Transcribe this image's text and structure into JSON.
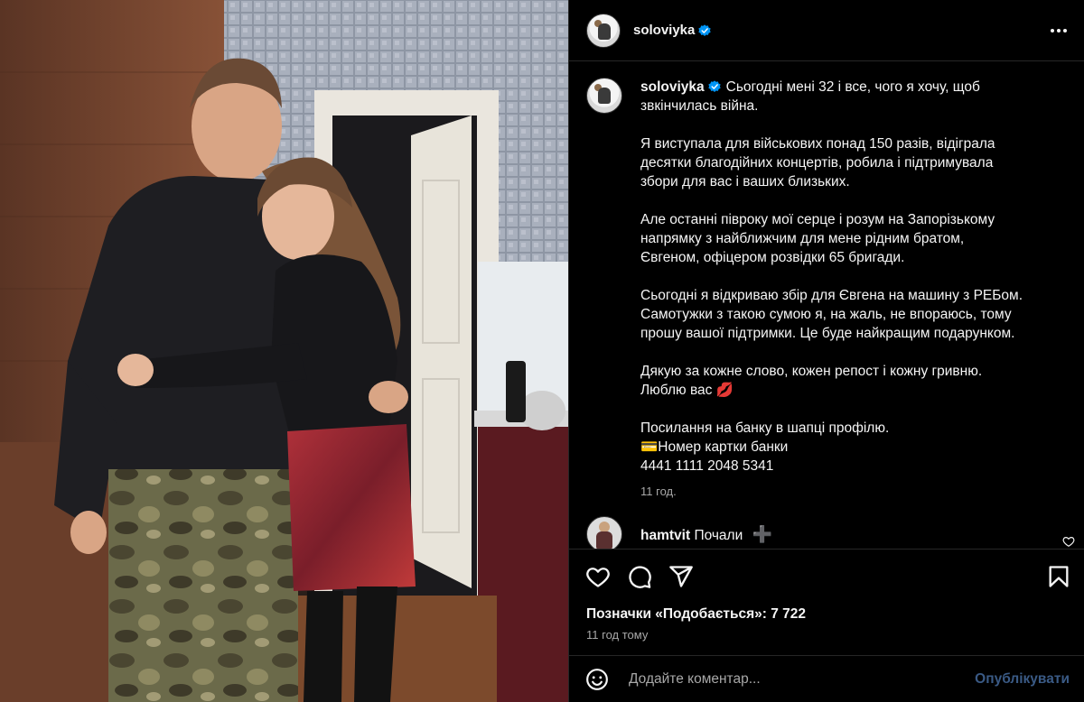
{
  "post": {
    "username": "soloviyka",
    "verified": true,
    "caption_lines": "Сьогодні мені 32 і все, чого я хочу, щоб\nзвкінчилась війна.\n\nЯ виступала для військових понад 150 разів, відіграла\nдесятки благодійних концертів, робила і підтримувала\nзбори для вас і ваших близьких.\n\nАле останні півроку мої серце і розум на Запорізькому\nнапрямку з найближчим для мене рідним братом,\nЄвгеном, офіцером розвідки 65 бригади.\n\nСьогодні я відкриваю збір для Євгена на машину з РЕБом.\nСамотужки з такою сумою я, на жаль, не впораюсь, тому\nпрошу вашої підтримки. Це буде найкращим подарунком.\n\nДякую за кожне слово, кожен репост і кожну гривню.\nЛюблю вас 💋\n\nПосилання на банку в шапці профілю.\n💳Номер картки банки\n4441 1111 2048 5341",
    "caption_time": "11 год."
  },
  "comment": {
    "username": "hamtvit",
    "text": "Почали",
    "plus": "➕"
  },
  "likes_text": "Позначки «Подобається»: 7 722",
  "posted_time": "11 год тому",
  "add_comment": {
    "placeholder": "Додайте коментар...",
    "publish_label": "Опублікувати"
  },
  "icons": {
    "more": "more-horizontal-icon",
    "like": "heart-outline-icon",
    "comment": "speech-bubble-icon",
    "share": "paper-plane-icon",
    "save": "bookmark-icon",
    "emoji": "smiley-icon"
  },
  "colors": {
    "background": "#000000",
    "text": "#f5f5f5",
    "muted": "#a8a8a8",
    "verified": "#0095f6",
    "publish_disabled": "#3a5a85"
  }
}
